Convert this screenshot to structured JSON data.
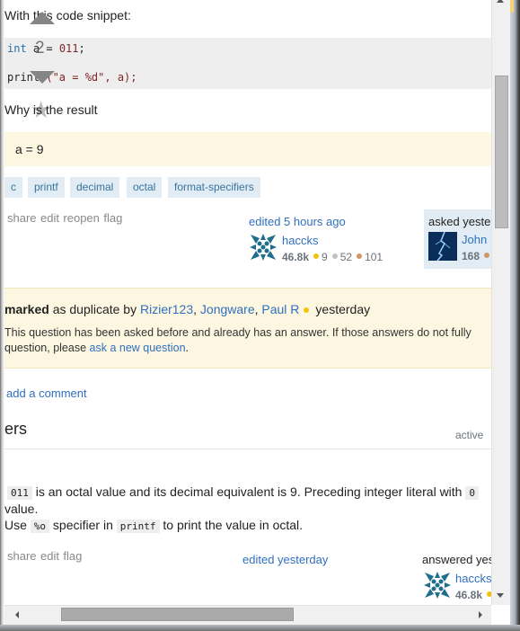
{
  "question": {
    "intro_text": "With this code snippet:",
    "code_lines": [
      {
        "keyword": "int",
        "rest_before": " a = ",
        "number": "011",
        "rest_after": ";"
      },
      {
        "prefix": "printf",
        "string": "(\"a = %d\", a);"
      }
    ],
    "why_text": "Why is the result",
    "result_text": "a = 9",
    "vote_count": "2",
    "tags": [
      "c",
      "printf",
      "decimal",
      "octal",
      "format-specifiers"
    ],
    "actions": [
      "share",
      "edit",
      "reopen",
      "flag"
    ],
    "editor": {
      "edited_label": "edited 5 hours ago",
      "name": "haccks",
      "reputation": "46.8k",
      "gold": "9",
      "silver": "52",
      "bronze": "101"
    },
    "owner": {
      "asked_label": "asked yesterday",
      "name": "John",
      "reputation": "168"
    }
  },
  "duplicate_notice": {
    "marked_label": "marked",
    "as_duplicate_by": " as duplicate by ",
    "users": [
      "Rizier123",
      "Jongware",
      "Paul R"
    ],
    "time": "yesterday",
    "message": "This question has been asked before and already has an answer. If those answers do not fully",
    "message_line2_prefix": "question, please ",
    "ask_link": "ask a new question",
    "message_line2_suffix": "."
  },
  "add_comment_label": "add a comment",
  "answers_header": {
    "title": "ers",
    "sort_active": "active"
  },
  "answer": {
    "line1_code": "011",
    "line1_text": " is an octal value and its decimal equivalent is 9. Preceding integer literal with ",
    "line1_code2": "0",
    "line2_text": "value.",
    "line3_prefix": "Use ",
    "line3_code1": "%o",
    "line3_mid": " specifier in ",
    "line3_code2": "printf",
    "line3_suffix": " to print the value in octal.",
    "actions": [
      "share",
      "edit",
      "flag"
    ],
    "edited_label": "edited yesterday",
    "answered_label": "answered yesterday",
    "author": {
      "name": "haccks",
      "reputation": "46.8k"
    }
  },
  "colors": {
    "link": "#2f6fbf",
    "tag_bg": "#e1ecf4",
    "tag_fg": "#39739d",
    "notice_bg": "#fdf7e2",
    "gold": "#f4c20d",
    "silver": "#c2c2c2",
    "bronze": "#cc9966"
  }
}
